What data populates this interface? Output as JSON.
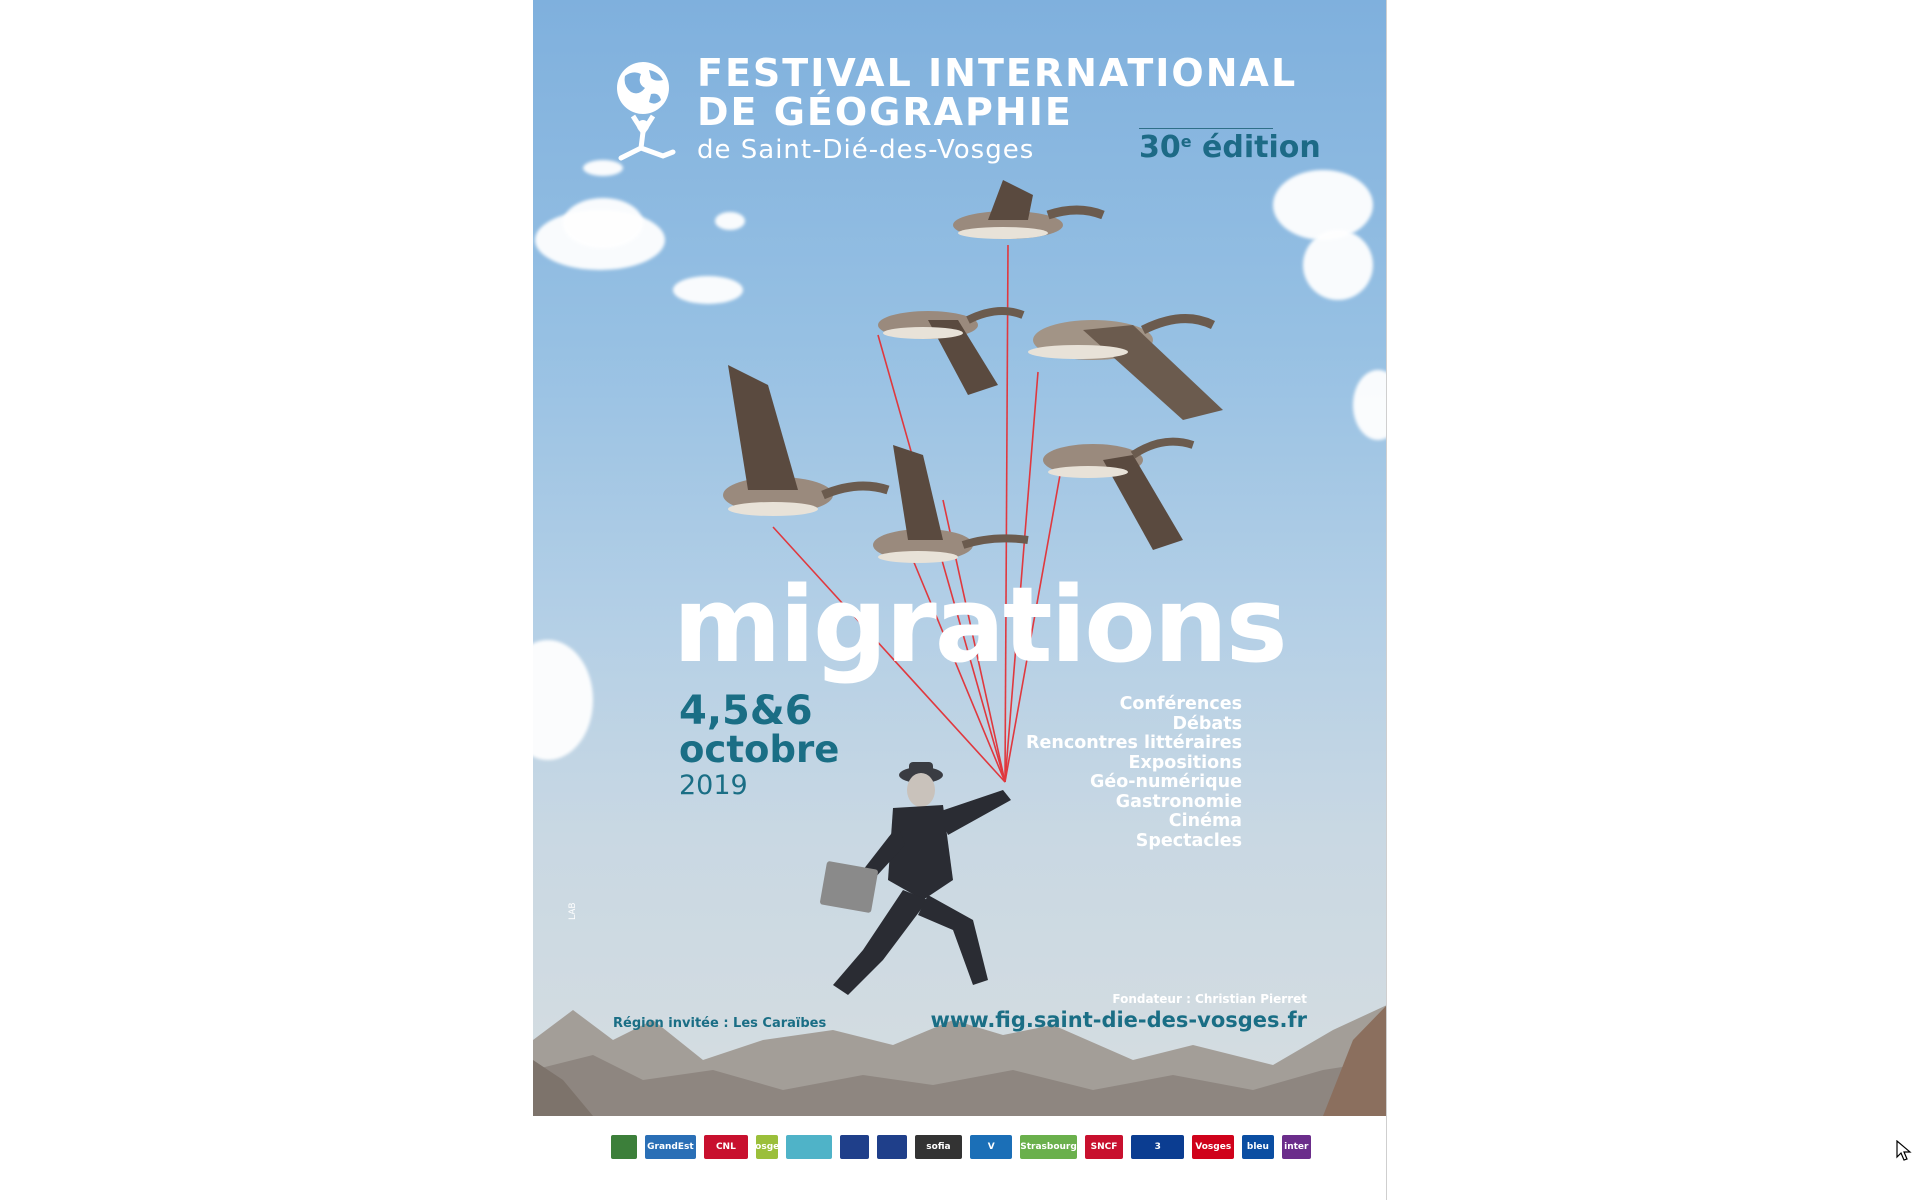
{
  "header": {
    "title_line1": "FESTIVAL INTERNATIONAL",
    "title_line2": "DE GÉOGRAPHIE",
    "subtitle": "de Saint-Dié-des-Vosges",
    "edition_number": "30",
    "edition_sup": "e",
    "edition_word": " édition"
  },
  "theme": "migrations",
  "dates": {
    "days": "4,5&6",
    "month": "octobre",
    "year": "2019"
  },
  "activities": [
    "Conférences",
    "Débats",
    "Rencontres littéraires",
    "Expositions",
    "Géo-numérique",
    "Gastronomie",
    "Cinéma",
    "Spectacles"
  ],
  "footer": {
    "founder": "Fondateur : Christian Pierret",
    "website": "www.fig.saint-die-des-vosges.fr",
    "region": "Région invitée : Les Caraïbes"
  },
  "side_credit": "LAB",
  "sponsors": [
    {
      "label": "",
      "icon": "city-crest-icon",
      "color": "#3c7f3a"
    },
    {
      "label": "GrandEst",
      "color": "#2a6fb6"
    },
    {
      "label": "CNL",
      "color": "#c8102e"
    },
    {
      "label": "vosges",
      "color": "#9bbf3a"
    },
    {
      "label": "",
      "icon": "agency-logo-icon",
      "color": "#4fb3c8"
    },
    {
      "label": "",
      "icon": "ministry-logo-icon",
      "color": "#1f3f8a"
    },
    {
      "label": "",
      "icon": "ministry-logo-icon",
      "color": "#1f3f8a"
    },
    {
      "label": "sofia",
      "color": "#333333"
    },
    {
      "label": "V",
      "color": "#1b6fb7"
    },
    {
      "label": "Strasbourg",
      "color": "#6ab04c"
    },
    {
      "label": "SNCF",
      "color": "#c8102e"
    },
    {
      "label": "3",
      "color": "#0b3d91"
    },
    {
      "label": "Vosges",
      "color": "#d0021b"
    },
    {
      "label": "bleu",
      "color": "#0b4ea2"
    },
    {
      "label": "inter",
      "color": "#6b2d8b"
    }
  ],
  "colors": {
    "accent": "#1a6e85",
    "string": "#e0383e"
  }
}
